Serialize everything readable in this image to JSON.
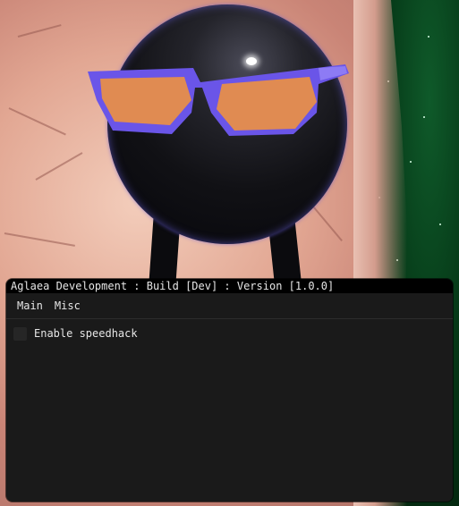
{
  "window": {
    "title": "Aglaea Development : Build [Dev] : Version [1.0.0]"
  },
  "menu": {
    "items": [
      "Main",
      "Misc"
    ]
  },
  "options": {
    "speedhack": {
      "label": "Enable speedhack",
      "checked": false
    }
  },
  "colors": {
    "window_bg": "#1a1a1a",
    "title_bg": "#000000",
    "text": "#e6e6e6",
    "checkbox_bg": "#262626"
  }
}
